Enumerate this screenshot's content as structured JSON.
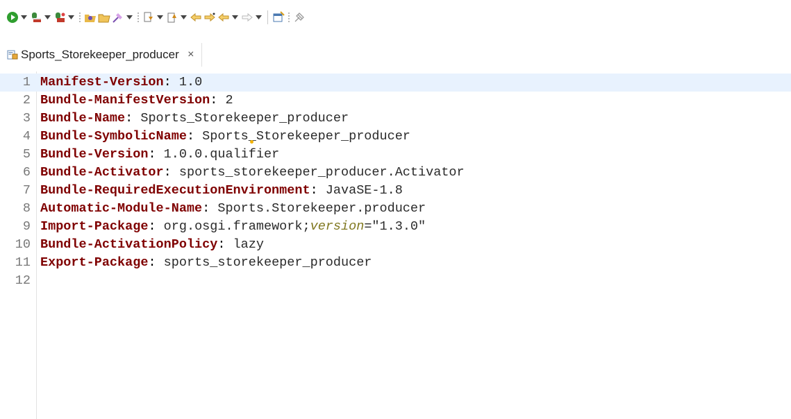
{
  "toolbar": {
    "icons": [
      "run-icon",
      "debug-icon",
      "coverage-icon",
      "open-type-icon",
      "open-task-icon",
      "search-icon",
      "next-annotation-icon",
      "previous-annotation-icon",
      "back-icon",
      "forward-icon",
      "back-nav-icon",
      "forward-nav-icon",
      "new-task-icon",
      "pin-editor-icon"
    ]
  },
  "editor_tab": {
    "label": "Sports_Storekeeper_producer",
    "close": "×"
  },
  "editor": {
    "lines": [
      {
        "number": "1",
        "key": "Manifest-Version",
        "sep": ": ",
        "value": "1.0"
      },
      {
        "number": "2",
        "key": "Bundle-ManifestVersion",
        "sep": ": ",
        "value": "2"
      },
      {
        "number": "3",
        "key": "Bundle-Name",
        "sep": ": ",
        "value": "Sports_Storekeeper_producer"
      },
      {
        "number": "4",
        "key": "Bundle-SymbolicName",
        "sep": ": ",
        "value": "Sports_Storekeeper_producer"
      },
      {
        "number": "5",
        "key": "Bundle-Version",
        "sep": ": ",
        "value": "1.0.0.qualifier"
      },
      {
        "number": "6",
        "key": "Bundle-Activator",
        "sep": ": ",
        "value": "sports_storekeeper_producer.Activator"
      },
      {
        "number": "7",
        "key": "Bundle-RequiredExecutionEnvironment",
        "sep": ": ",
        "value": "JavaSE-1.8"
      },
      {
        "number": "8",
        "key": "Automatic-Module-Name",
        "sep": ": ",
        "value": "Sports.Storekeeper.producer"
      },
      {
        "number": "9",
        "key": "Import-Package",
        "sep": ": ",
        "value": "org.osgi.framework;",
        "attr": "version",
        "attr_value": "=\"1.3.0\""
      },
      {
        "number": "10",
        "key": "Bundle-ActivationPolicy",
        "sep": ": ",
        "value": "lazy"
      },
      {
        "number": "11",
        "key": "Export-Package",
        "sep": ": ",
        "value": "sports_storekeeper_producer"
      },
      {
        "number": "12",
        "key": "",
        "sep": "",
        "value": ""
      }
    ],
    "current_line": 1
  },
  "colors": {
    "manifest_key": "#7f0000",
    "manifest_attr": "#807820",
    "current_line_bg": "#e8f2fe"
  }
}
